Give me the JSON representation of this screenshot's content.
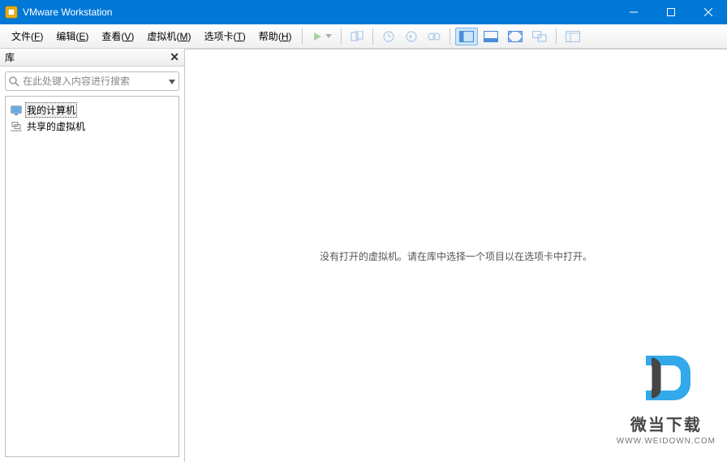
{
  "title": "VMware Workstation",
  "menu": {
    "file": "文件",
    "file_k": "F",
    "edit": "编辑",
    "edit_k": "E",
    "view": "查看",
    "view_k": "V",
    "vm": "虚拟机",
    "vm_k": "M",
    "tabs": "选项卡",
    "tabs_k": "T",
    "help": "帮助",
    "help_k": "H"
  },
  "sidebar": {
    "title": "库",
    "search_placeholder": "在此处键入内容进行搜索",
    "items": [
      {
        "label": "我的计算机",
        "selected": true
      },
      {
        "label": "共享的虚拟机",
        "selected": false
      }
    ]
  },
  "main": {
    "empty_message": "没有打开的虚拟机。请在库中选择一个项目以在选项卡中打开。"
  },
  "watermark": {
    "text": "微当下载",
    "url": "WWW.WEIDOWN.COM"
  }
}
